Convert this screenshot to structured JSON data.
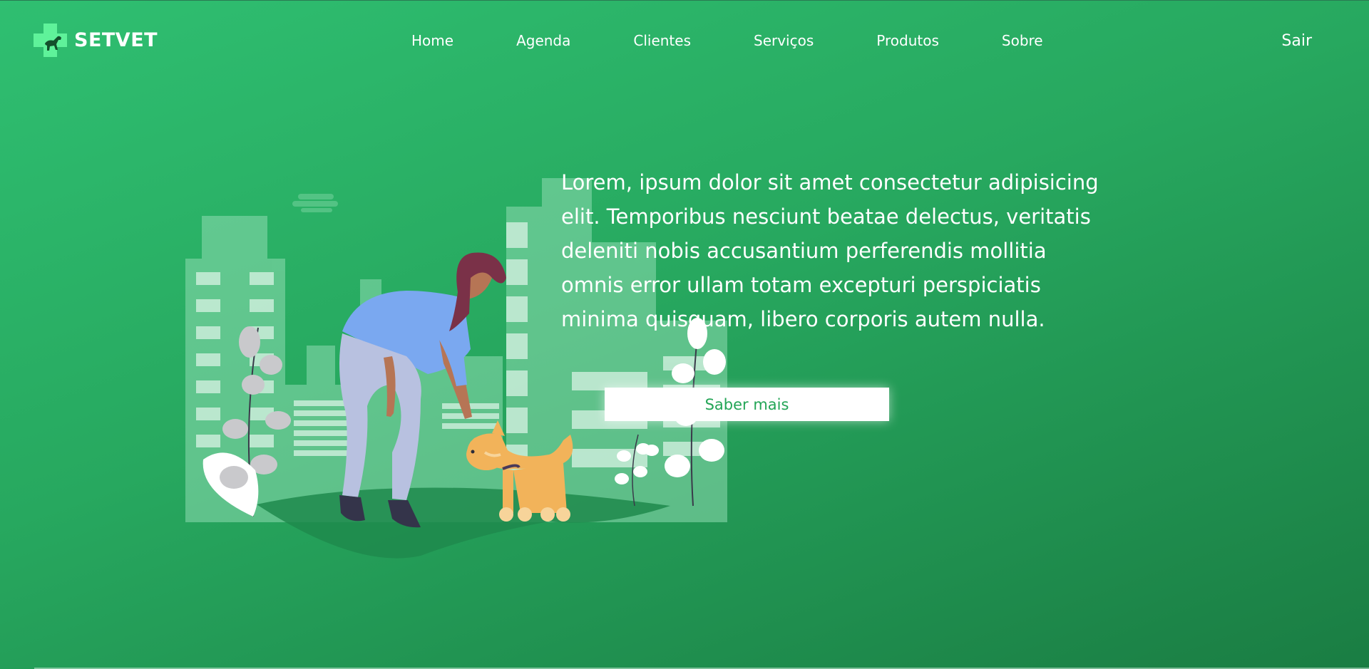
{
  "brand": {
    "name": "SETVET",
    "logo_icon": "cross-dog-icon",
    "logo_color": "#5ff29a"
  },
  "nav": {
    "items": [
      {
        "label": "Home"
      },
      {
        "label": "Agenda"
      },
      {
        "label": "Clientes"
      },
      {
        "label": "Serviços"
      },
      {
        "label": "Produtos"
      },
      {
        "label": "Sobre"
      }
    ],
    "logout_label": "Sair"
  },
  "hero": {
    "text": "Lorem, ipsum dolor sit amet consectetur adipisicing elit. Temporibus nesciunt beatae delectus, veritatis deleniti nobis accusantium perferendis mollitia omnis error ullam totam excepturi perspiciatis minima quisquam, libero corporis autem nulla.",
    "cta_label": "Saber mais",
    "illustration": "woman-petting-dog-in-city-illustration"
  },
  "colors": {
    "background_start": "#2fbf71",
    "background_end": "#1a7d43",
    "cta_text": "#23a556"
  }
}
